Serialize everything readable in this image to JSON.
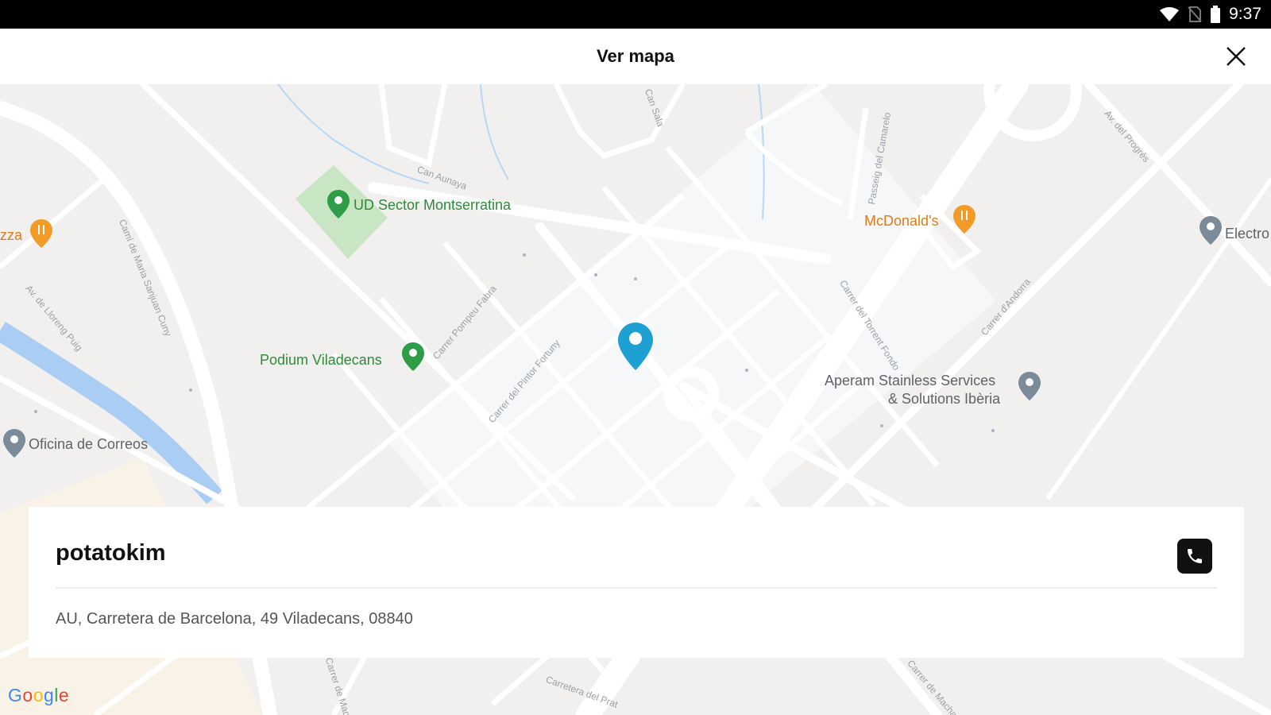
{
  "status_bar": {
    "time": "9:37"
  },
  "header": {
    "title": "Ver mapa",
    "close_icon": "close-icon"
  },
  "map": {
    "pois": [
      {
        "label": "UD Sector Montserratina",
        "kind": "park",
        "color": "#2e8b3a"
      },
      {
        "label": "Podium Viladecans",
        "kind": "sports",
        "color": "#2e8b3a"
      },
      {
        "label": "McDonald's",
        "kind": "restaurant",
        "color": "#e07b17"
      },
      {
        "label": "zza",
        "kind": "restaurant",
        "color": "#e07b17"
      },
      {
        "label": "Oficina de Correos",
        "kind": "service",
        "color": "#5f6368"
      },
      {
        "label": "Aperam Stainless Services",
        "label_line2": "& Solutions Ibèria",
        "kind": "business",
        "color": "#5f6368"
      },
      {
        "label": "Electro",
        "kind": "business",
        "color": "#5f6368"
      }
    ],
    "streets": [
      "Camí de Maria Sanjuan Cuny",
      "Av. de Lloreng Puig",
      "Can Aunaya",
      "Can Sala",
      "Passeig del Camarelo",
      "Carrer Pompeu Fabra",
      "Carrer del Pintor Fortuny",
      "Carrer del Torrent Fondo",
      "Carrer d'Andorra",
      "Av. del Progrés",
      "Carretera del Prat",
      "Carrer de Macià",
      "Carrer de Machado"
    ],
    "marker_color": "#1ea1d2",
    "attribution": "Google"
  },
  "card": {
    "name": "potatokim",
    "address": "AU, Carretera de Barcelona, 49 Viladecans, 08840",
    "phone_icon": "phone-icon"
  }
}
